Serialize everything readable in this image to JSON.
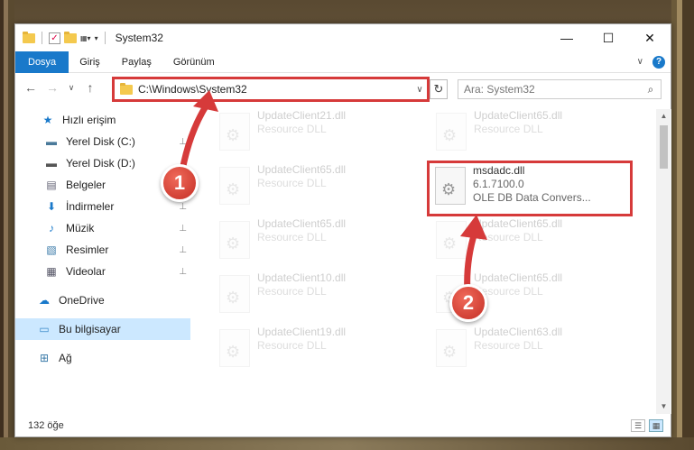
{
  "window": {
    "title": "System32",
    "controls": {
      "minimize": "—",
      "maximize": "☐",
      "close": "✕"
    }
  },
  "ribbon": {
    "tabs": [
      {
        "label": "Dosya"
      },
      {
        "label": "Giriş"
      },
      {
        "label": "Paylaş"
      },
      {
        "label": "Görünüm"
      }
    ],
    "expand": "∨",
    "help": "?"
  },
  "nav": {
    "back": "←",
    "forward": "→",
    "recent": "∨",
    "up": "↑",
    "address": "C:\\Windows\\System32",
    "address_dropdown": "∨",
    "refresh": "↻",
    "search_placeholder": "Ara: System32",
    "search_icon": "⌕"
  },
  "sidebar": {
    "items": [
      {
        "label": "Hızlı erişim",
        "icon": "star-icon",
        "glyph": "★",
        "color": "#1979ca",
        "pinned": false
      },
      {
        "label": "Yerel Disk (C:)",
        "icon": "drive-icon",
        "glyph": "▬",
        "color": "#4a7a9a",
        "pinned": true
      },
      {
        "label": "Yerel Disk (D:)",
        "icon": "drive-icon",
        "glyph": "▬",
        "color": "#555",
        "pinned": true
      },
      {
        "label": "Belgeler",
        "icon": "documents-icon",
        "glyph": "▤",
        "color": "#667",
        "pinned": true
      },
      {
        "label": "İndirmeler",
        "icon": "download-icon",
        "glyph": "⬇",
        "color": "#1979ca",
        "pinned": true
      },
      {
        "label": "Müzik",
        "icon": "music-icon",
        "glyph": "♪",
        "color": "#1979ca",
        "pinned": true
      },
      {
        "label": "Resimler",
        "icon": "pictures-icon",
        "glyph": "▧",
        "color": "#3a7aa8",
        "pinned": true
      },
      {
        "label": "Videolar",
        "icon": "videos-icon",
        "glyph": "▦",
        "color": "#556",
        "pinned": true
      },
      {
        "label": "OneDrive",
        "icon": "cloud-icon",
        "glyph": "☁",
        "color": "#1979ca",
        "pinned": false
      },
      {
        "label": "Bu bilgisayar",
        "icon": "computer-icon",
        "glyph": "▭",
        "color": "#3a8ac8",
        "pinned": false
      },
      {
        "label": "Ağ",
        "icon": "network-icon",
        "glyph": "⊞",
        "color": "#3a7aa8",
        "pinned": false
      }
    ],
    "pin_glyph": "📌"
  },
  "files": {
    "left": [
      {
        "name": "UpdateClient21.dll",
        "desc": "Resource DLL"
      },
      {
        "name": "UpdateClient65.dll",
        "desc": "Resource DLL"
      },
      {
        "name": "UpdateClient65.dll",
        "desc": "Resource DLL"
      },
      {
        "name": "UpdateClient10.dll",
        "desc": "Resource DLL"
      },
      {
        "name": "UpdateClient19.dll",
        "desc": "Resource DLL"
      }
    ],
    "right": [
      {
        "name": "UpdateClient65.dll",
        "desc": "Resource DLL"
      },
      {
        "name": "UpdateClient65.dll",
        "desc": "Resource DLL"
      },
      {
        "name": "UpdateClient65.dll",
        "desc": "Resource DLL"
      },
      {
        "name": "UpdateClient63.dll",
        "desc": "Resource DLL"
      }
    ],
    "highlighted": {
      "name": "msdadc.dll",
      "version": "6.1.7100.0",
      "description": "OLE DB Data Convers..."
    }
  },
  "status": {
    "count": "132 öğe",
    "view_details": "☰",
    "view_tiles": "▦"
  },
  "callouts": {
    "one": "1",
    "two": "2",
    "color": "#d63a3a"
  }
}
